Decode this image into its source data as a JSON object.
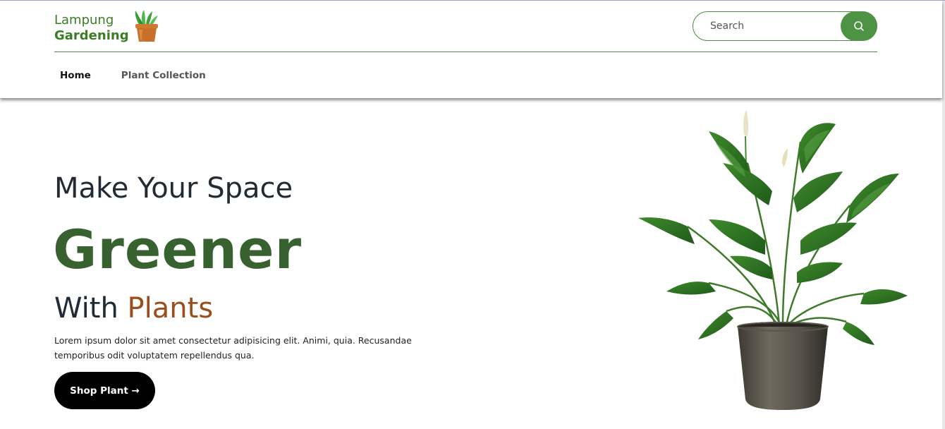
{
  "header": {
    "logo": {
      "line1": "Lampung",
      "line2": "Gardening",
      "icon": "potted-plant-icon"
    },
    "search": {
      "placeholder": "Search",
      "icon": "search-icon"
    },
    "nav": [
      {
        "label": "Home",
        "active": true
      },
      {
        "label": "Plant Collection",
        "active": false
      }
    ]
  },
  "hero": {
    "line1": "Make Your Space",
    "line2": "Greener",
    "line3_prefix": "With ",
    "line3_accent": "Plants",
    "description": "Lorem ipsum dolor sit amet consectetur adipisicing elit. Animi, quia. Recusandae temporibus odit voluptatem repellendus qua.",
    "cta_label": "Shop Plant →",
    "image": "potted-peace-lily-plant"
  },
  "colors": {
    "brand_green": "#3a7d25",
    "dark_green": "#37612f",
    "accent_brown": "#9a4e1e",
    "button_black": "#000000",
    "search_button": "#4e9244"
  }
}
